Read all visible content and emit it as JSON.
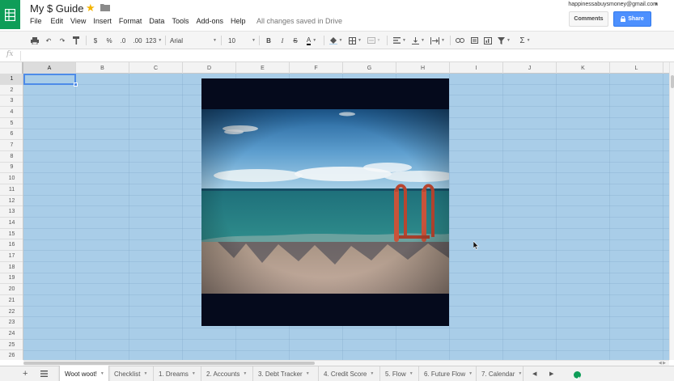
{
  "app": {
    "title": "My $ Guide",
    "save_status": "All changes saved in Drive",
    "account_email": "happinessabuysmoney@gmail.com",
    "brand_color": "#0f9d58"
  },
  "menu": [
    "File",
    "Edit",
    "View",
    "Insert",
    "Format",
    "Data",
    "Tools",
    "Add-ons",
    "Help"
  ],
  "header_buttons": {
    "comments": "Comments",
    "share": "Share",
    "share_color": "#4d90fe"
  },
  "toolbar": {
    "currency": "$",
    "percent": "%",
    "decrease_decimals": ".0",
    "increase_decimals": ".00",
    "more_formats": "123",
    "font": "Arial",
    "font_size": "10",
    "bold": "B",
    "italic": "I",
    "strikethrough": "S",
    "text_color": "A",
    "functions": "Σ"
  },
  "formula_bar": {
    "fx": "fx",
    "value": ""
  },
  "grid": {
    "columns": [
      "A",
      "B",
      "C",
      "D",
      "E",
      "F",
      "G",
      "H",
      "I",
      "J",
      "K",
      "L"
    ],
    "rows": [
      "1",
      "2",
      "3",
      "4",
      "5",
      "6",
      "7",
      "8",
      "9",
      "10",
      "11",
      "12",
      "13",
      "14",
      "15",
      "16",
      "17",
      "18",
      "19",
      "20",
      "21",
      "22",
      "23",
      "24",
      "25",
      "26"
    ],
    "selected_cell": "A1",
    "cell_background": "#a9cde8"
  },
  "sheet_tabs": [
    {
      "label": "Woot woot!",
      "active": true
    },
    {
      "label": "Checklist",
      "active": false
    },
    {
      "label": "1. Dreams",
      "active": false
    },
    {
      "label": "2. Accounts",
      "active": false
    },
    {
      "label": "3. Debt Tracker",
      "active": false
    },
    {
      "label": "4. Credit Score",
      "active": false
    },
    {
      "label": "5. Flow",
      "active": false
    },
    {
      "label": "6. Future Flow",
      "active": false
    },
    {
      "label": "7. Calendar",
      "active": false
    }
  ]
}
